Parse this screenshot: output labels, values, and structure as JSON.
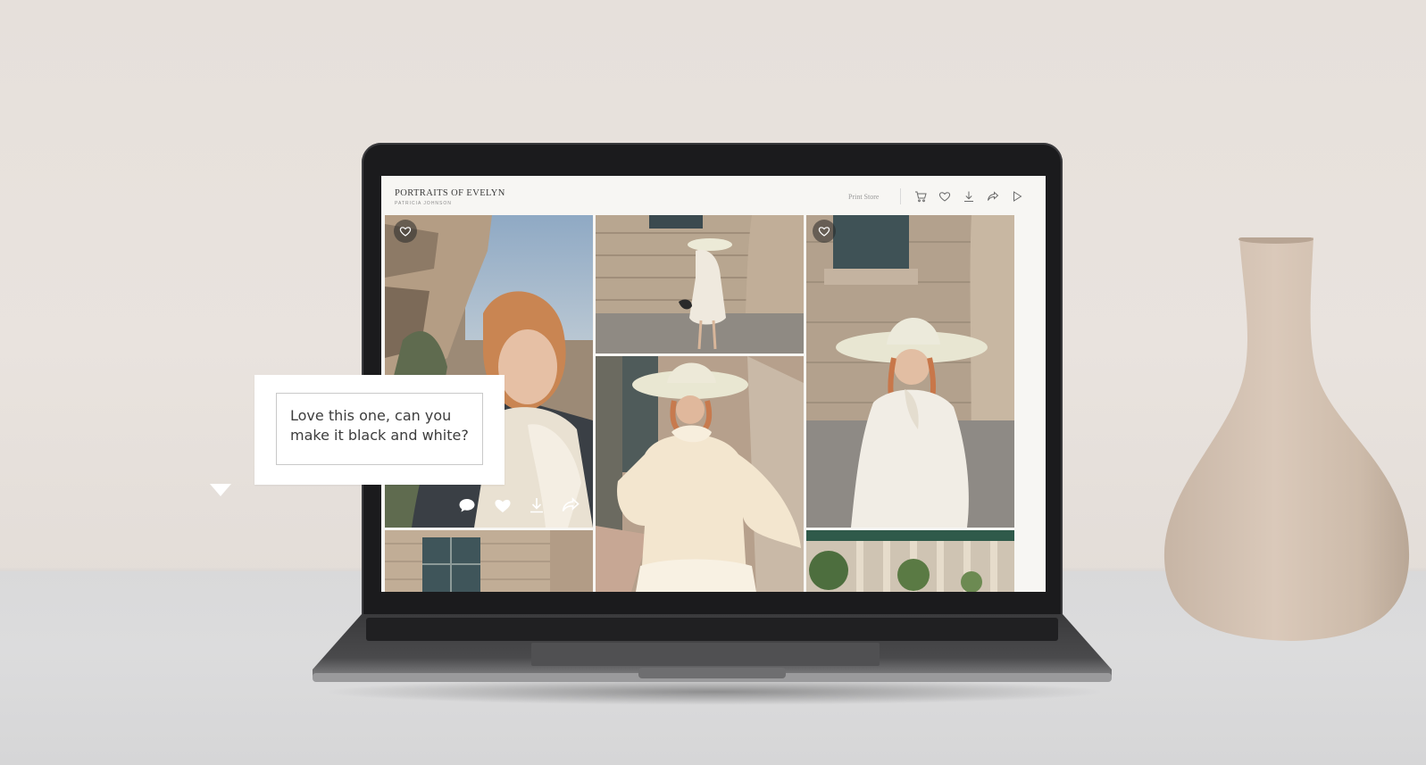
{
  "gallery": {
    "title": "PORTRAITS OF EVELYN",
    "subtitle": "PATRICIA JOHNSON"
  },
  "header": {
    "print_store_label": "Print Store",
    "icons": [
      "cart-icon",
      "heart-icon",
      "download-icon",
      "share-icon",
      "slideshow-play-icon"
    ]
  },
  "photos": [
    {
      "name": "photo-portrait-closeup",
      "favorite_icon": "heart-icon"
    },
    {
      "name": "photo-walking-hat"
    },
    {
      "name": "photo-standing-hat",
      "favorite_icon": "heart-icon"
    },
    {
      "name": "photo-ruffled-blouse"
    },
    {
      "name": "photo-window-facade"
    },
    {
      "name": "photo-columns-garden"
    }
  ],
  "photo_actions": [
    "comment-icon",
    "heart-filled-icon",
    "download-icon",
    "share-icon"
  ],
  "comment": {
    "text": "Love this one, can you make it black and white?"
  },
  "colors": {
    "wall": "#e7e1dc",
    "table": "#d9d9da",
    "screen_bg": "#f7f6f3",
    "vase": "#d3c2b2"
  }
}
